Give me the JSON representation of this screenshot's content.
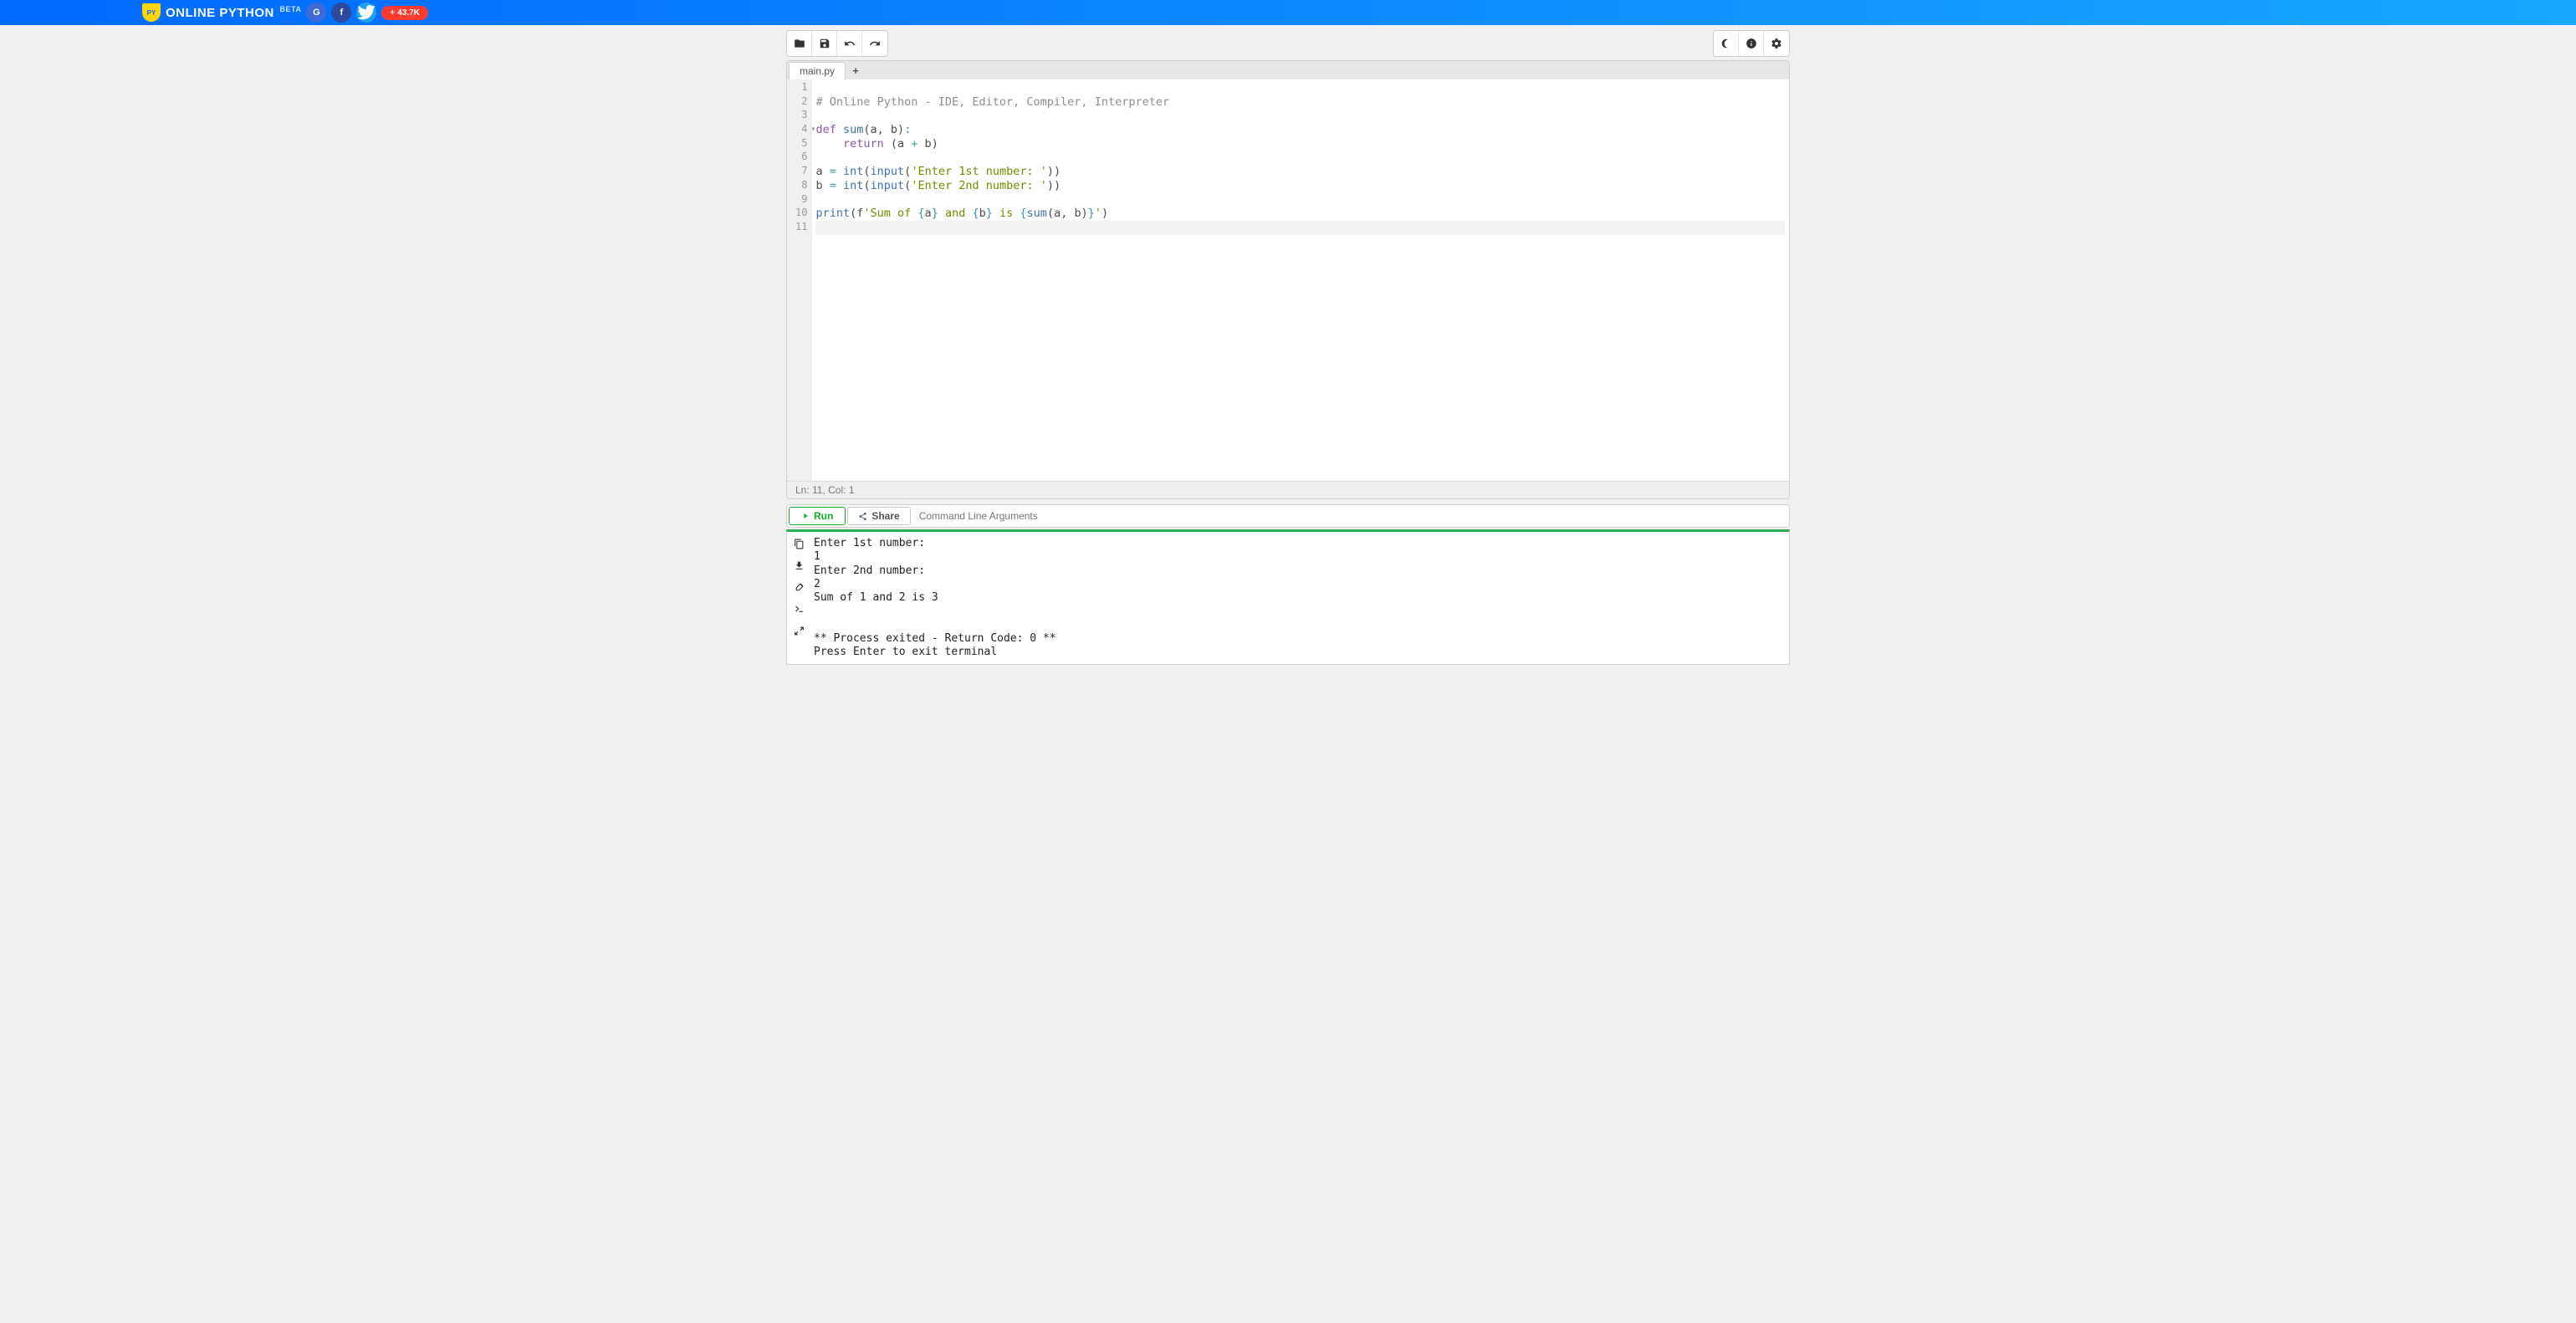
{
  "header": {
    "title": "ONLINE PYTHON",
    "badge_label": "BETA",
    "logo_short": "PY",
    "share_count": "43.7K"
  },
  "tabs": {
    "active": "main.py"
  },
  "code": {
    "lines": [
      {
        "n": "1",
        "fold": "",
        "tokens": []
      },
      {
        "n": "2",
        "fold": "",
        "tokens": [
          [
            "comment",
            "# Online Python - IDE, Editor, Compiler, Interpreter"
          ]
        ]
      },
      {
        "n": "3",
        "fold": "",
        "tokens": []
      },
      {
        "n": "4",
        "fold": "-",
        "tokens": [
          [
            "keyword",
            "def "
          ],
          [
            "name",
            "sum"
          ],
          [
            "default",
            "("
          ],
          [
            "default",
            "a"
          ],
          [
            "default",
            ", "
          ],
          [
            "default",
            "b"
          ],
          [
            "default",
            ")"
          ],
          [
            "op",
            ":"
          ]
        ]
      },
      {
        "n": "5",
        "fold": "",
        "tokens": [
          [
            "default",
            "    "
          ],
          [
            "keyword",
            "return "
          ],
          [
            "default",
            "("
          ],
          [
            "default",
            "a "
          ],
          [
            "op",
            "+"
          ],
          [
            "default",
            " b"
          ],
          [
            "default",
            ")"
          ]
        ]
      },
      {
        "n": "6",
        "fold": "",
        "tokens": []
      },
      {
        "n": "7",
        "fold": "",
        "tokens": [
          [
            "default",
            "a "
          ],
          [
            "op",
            "="
          ],
          [
            "default",
            " "
          ],
          [
            "builtin",
            "int"
          ],
          [
            "default",
            "("
          ],
          [
            "builtin",
            "input"
          ],
          [
            "default",
            "("
          ],
          [
            "string",
            "'Enter 1st number: '"
          ],
          [
            "default",
            "))"
          ]
        ]
      },
      {
        "n": "8",
        "fold": "",
        "tokens": [
          [
            "default",
            "b "
          ],
          [
            "op",
            "="
          ],
          [
            "default",
            " "
          ],
          [
            "builtin",
            "int"
          ],
          [
            "default",
            "("
          ],
          [
            "builtin",
            "input"
          ],
          [
            "default",
            "("
          ],
          [
            "string",
            "'Enter 2nd number: '"
          ],
          [
            "default",
            "))"
          ]
        ]
      },
      {
        "n": "9",
        "fold": "",
        "tokens": []
      },
      {
        "n": "10",
        "fold": "",
        "tokens": [
          [
            "builtin",
            "print"
          ],
          [
            "default",
            "("
          ],
          [
            "default",
            "f"
          ],
          [
            "string",
            "'Sum of "
          ],
          [
            "op",
            "{"
          ],
          [
            "default",
            "a"
          ],
          [
            "op",
            "}"
          ],
          [
            "string",
            " and "
          ],
          [
            "op",
            "{"
          ],
          [
            "default",
            "b"
          ],
          [
            "op",
            "}"
          ],
          [
            "string",
            " is "
          ],
          [
            "op",
            "{"
          ],
          [
            "builtin",
            "sum"
          ],
          [
            "default",
            "("
          ],
          [
            "default",
            "a"
          ],
          [
            "default",
            ", "
          ],
          [
            "default",
            "b"
          ],
          [
            "default",
            ")"
          ],
          [
            "op",
            "}"
          ],
          [
            "string",
            "'"
          ],
          [
            "default",
            ")"
          ]
        ]
      },
      {
        "n": "11",
        "fold": "",
        "tokens": [],
        "active": true
      }
    ]
  },
  "status": {
    "text": "Ln: 11,  Col: 1"
  },
  "actions": {
    "run_label": "Run",
    "share_label": "Share",
    "cli_placeholder": "Command Line Arguments"
  },
  "terminal": {
    "lines": [
      "Enter 1st number: ",
      "1",
      "Enter 2nd number: ",
      "2",
      "Sum of 1 and 2 is 3",
      "",
      "",
      "** Process exited - Return Code: 0 **",
      "Press Enter to exit terminal"
    ]
  }
}
